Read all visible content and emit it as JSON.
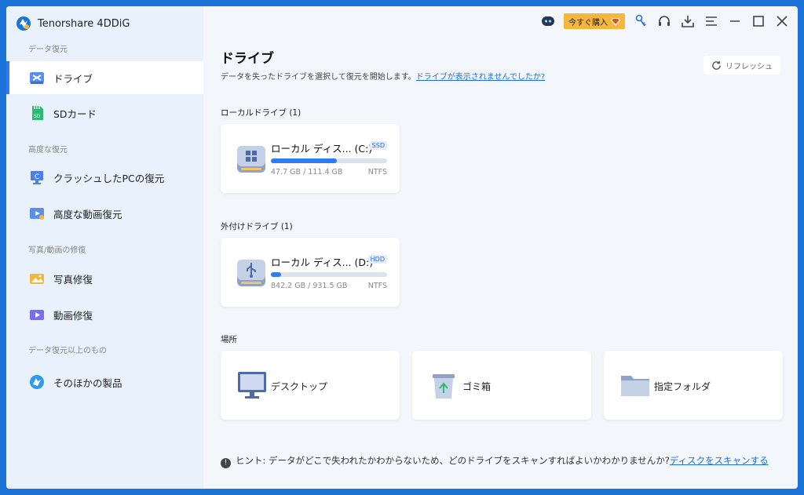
{
  "app": {
    "title": "Tenorshare 4DDiG"
  },
  "topbar": {
    "buy_label": "今すぐ購入"
  },
  "sidebar": {
    "sections": [
      {
        "label": "データ復元"
      },
      {
        "label": "高度な復元"
      },
      {
        "label": "写真/動画の修復"
      },
      {
        "label": "データ復元以上のもの"
      }
    ],
    "items": [
      {
        "label": "ドライブ",
        "icon": "drive-icon",
        "active": true
      },
      {
        "label": "SDカード",
        "icon": "sd-card-icon"
      },
      {
        "label": "クラッシュしたPCの復元",
        "icon": "crashed-pc-icon"
      },
      {
        "label": "高度な動画復元",
        "icon": "video-recovery-icon"
      },
      {
        "label": "写真修復",
        "icon": "photo-repair-icon"
      },
      {
        "label": "動画修復",
        "icon": "video-repair-icon"
      },
      {
        "label": "そのほかの製品",
        "icon": "other-products-icon"
      }
    ]
  },
  "main": {
    "title": "ドライブ",
    "description": "データを失ったドライブを選択して復元を開始します。",
    "description_link": "ドライブが表示されませんでしたか?",
    "refresh_label": "リフレッシュ",
    "local_header": "ローカルドライブ (1)",
    "external_header": "外付けドライブ (1)",
    "locations_header": "場所",
    "drives": [
      {
        "name": "ローカル ディス... (C:)",
        "type": "SSD",
        "used": "47.7 GB / 111.4 GB",
        "fs": "NTFS",
        "usage": 0.57,
        "color": "#2d7cf6"
      },
      {
        "name": "ローカル ディス... (D:)",
        "type": "HDD",
        "used": "842.2 GB / 931.5 GB",
        "fs": "NTFS",
        "usage": 0.09,
        "color": "#2d7cf6"
      }
    ],
    "locations": [
      {
        "label": "デスクトップ",
        "icon": "desktop-icon"
      },
      {
        "label": "ゴミ箱",
        "icon": "recycle-bin-icon"
      },
      {
        "label": "指定フォルダ",
        "icon": "folder-icon"
      }
    ],
    "hint_prefix": "ヒント:",
    "hint_text": "データがどこで失われたかわからないため、どのドライブをスキャンすればよいかわかりませんか?",
    "hint_link": "ディスクをスキャンする"
  },
  "colors": {
    "accent": "#2d7cf6",
    "background": "#1c74d9",
    "sidebar": "#e8f1fc",
    "buy": "#f4b63b"
  }
}
